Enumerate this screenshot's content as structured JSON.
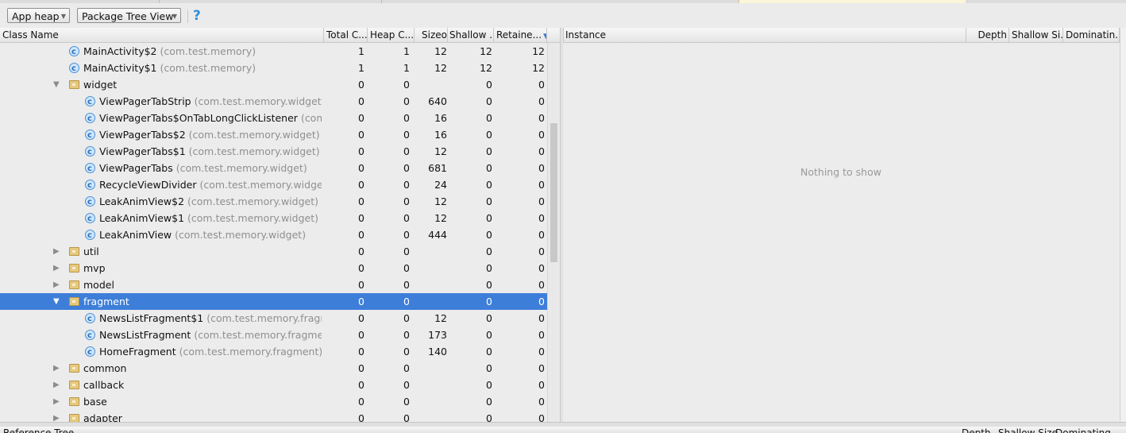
{
  "toolbar": {
    "heap_select": "App heap",
    "view_select": "Package Tree View",
    "help_label": "?"
  },
  "left_columns": [
    "Class Name",
    "Total C...",
    "Heap C...",
    "Sizeof",
    "Shallow ...",
    "Retaine..."
  ],
  "right_columns": [
    "Instance",
    "Depth",
    "Shallow Si...",
    "Dominatin..."
  ],
  "rows": [
    {
      "kind": "class",
      "depth": 1,
      "name": "MainActivity$2",
      "pkg": "(com.test.memory)",
      "total": "1",
      "heap": "1",
      "sizeof": "12",
      "shallow": "12",
      "retained": "12"
    },
    {
      "kind": "class",
      "depth": 1,
      "name": "MainActivity$1",
      "pkg": "(com.test.memory)",
      "total": "1",
      "heap": "1",
      "sizeof": "12",
      "shallow": "12",
      "retained": "12"
    },
    {
      "kind": "package",
      "depth": 0,
      "expanded": true,
      "name": "widget",
      "pkg": "",
      "total": "0",
      "heap": "0",
      "sizeof": "",
      "shallow": "0",
      "retained": "0"
    },
    {
      "kind": "class",
      "depth": 2,
      "name": "ViewPagerTabStrip",
      "pkg": "(com.test.memory.widget)",
      "total": "0",
      "heap": "0",
      "sizeof": "640",
      "shallow": "0",
      "retained": "0"
    },
    {
      "kind": "class",
      "depth": 2,
      "name": "ViewPagerTabs$OnTabLongClickListener",
      "pkg": "(com.te",
      "total": "0",
      "heap": "0",
      "sizeof": "16",
      "shallow": "0",
      "retained": "0"
    },
    {
      "kind": "class",
      "depth": 2,
      "name": "ViewPagerTabs$2",
      "pkg": "(com.test.memory.widget)",
      "total": "0",
      "heap": "0",
      "sizeof": "16",
      "shallow": "0",
      "retained": "0"
    },
    {
      "kind": "class",
      "depth": 2,
      "name": "ViewPagerTabs$1",
      "pkg": "(com.test.memory.widget)",
      "total": "0",
      "heap": "0",
      "sizeof": "12",
      "shallow": "0",
      "retained": "0"
    },
    {
      "kind": "class",
      "depth": 2,
      "name": "ViewPagerTabs",
      "pkg": "(com.test.memory.widget)",
      "total": "0",
      "heap": "0",
      "sizeof": "681",
      "shallow": "0",
      "retained": "0"
    },
    {
      "kind": "class",
      "depth": 2,
      "name": "RecycleViewDivider",
      "pkg": "(com.test.memory.widget)",
      "total": "0",
      "heap": "0",
      "sizeof": "24",
      "shallow": "0",
      "retained": "0"
    },
    {
      "kind": "class",
      "depth": 2,
      "name": "LeakAnimView$2",
      "pkg": "(com.test.memory.widget)",
      "total": "0",
      "heap": "0",
      "sizeof": "12",
      "shallow": "0",
      "retained": "0"
    },
    {
      "kind": "class",
      "depth": 2,
      "name": "LeakAnimView$1",
      "pkg": "(com.test.memory.widget)",
      "total": "0",
      "heap": "0",
      "sizeof": "12",
      "shallow": "0",
      "retained": "0"
    },
    {
      "kind": "class",
      "depth": 2,
      "name": "LeakAnimView",
      "pkg": "(com.test.memory.widget)",
      "total": "0",
      "heap": "0",
      "sizeof": "444",
      "shallow": "0",
      "retained": "0"
    },
    {
      "kind": "package",
      "depth": 0,
      "expanded": false,
      "name": "util",
      "pkg": "",
      "total": "0",
      "heap": "0",
      "sizeof": "",
      "shallow": "0",
      "retained": "0"
    },
    {
      "kind": "package",
      "depth": 0,
      "expanded": false,
      "name": "mvp",
      "pkg": "",
      "total": "0",
      "heap": "0",
      "sizeof": "",
      "shallow": "0",
      "retained": "0"
    },
    {
      "kind": "package",
      "depth": 0,
      "expanded": false,
      "name": "model",
      "pkg": "",
      "total": "0",
      "heap": "0",
      "sizeof": "",
      "shallow": "0",
      "retained": "0"
    },
    {
      "kind": "package",
      "depth": 0,
      "expanded": true,
      "selected": true,
      "name": "fragment",
      "pkg": "",
      "total": "0",
      "heap": "0",
      "sizeof": "",
      "shallow": "0",
      "retained": "0"
    },
    {
      "kind": "class",
      "depth": 2,
      "name": "NewsListFragment$1",
      "pkg": "(com.test.memory.fragmen",
      "total": "0",
      "heap": "0",
      "sizeof": "12",
      "shallow": "0",
      "retained": "0"
    },
    {
      "kind": "class",
      "depth": 2,
      "name": "NewsListFragment",
      "pkg": "(com.test.memory.fragment)",
      "total": "0",
      "heap": "0",
      "sizeof": "173",
      "shallow": "0",
      "retained": "0"
    },
    {
      "kind": "class",
      "depth": 2,
      "name": "HomeFragment",
      "pkg": "(com.test.memory.fragment)",
      "total": "0",
      "heap": "0",
      "sizeof": "140",
      "shallow": "0",
      "retained": "0"
    },
    {
      "kind": "package",
      "depth": 0,
      "expanded": false,
      "name": "common",
      "pkg": "",
      "total": "0",
      "heap": "0",
      "sizeof": "",
      "shallow": "0",
      "retained": "0"
    },
    {
      "kind": "package",
      "depth": 0,
      "expanded": false,
      "name": "callback",
      "pkg": "",
      "total": "0",
      "heap": "0",
      "sizeof": "",
      "shallow": "0",
      "retained": "0"
    },
    {
      "kind": "package",
      "depth": 0,
      "expanded": false,
      "name": "base",
      "pkg": "",
      "total": "0",
      "heap": "0",
      "sizeof": "",
      "shallow": "0",
      "retained": "0"
    },
    {
      "kind": "package",
      "depth": 0,
      "expanded": false,
      "name": "adapter",
      "pkg": "",
      "total": "0",
      "heap": "0",
      "sizeof": "",
      "shallow": "0",
      "retained": "0"
    }
  ],
  "instance_panel": {
    "empty_text": "Nothing to show"
  },
  "bottom_panel": {
    "title": "Reference Tree",
    "columns": [
      "Depth",
      "Shallow Size",
      "Dominating"
    ]
  },
  "colors": {
    "selection": "#3d7ed9",
    "package_text": "#8f8f8f",
    "help_icon": "#2f8fd8"
  },
  "icons": {
    "class": "class-c-icon",
    "package": "package-folder-icon",
    "expand": "expand-triangle-icon"
  }
}
